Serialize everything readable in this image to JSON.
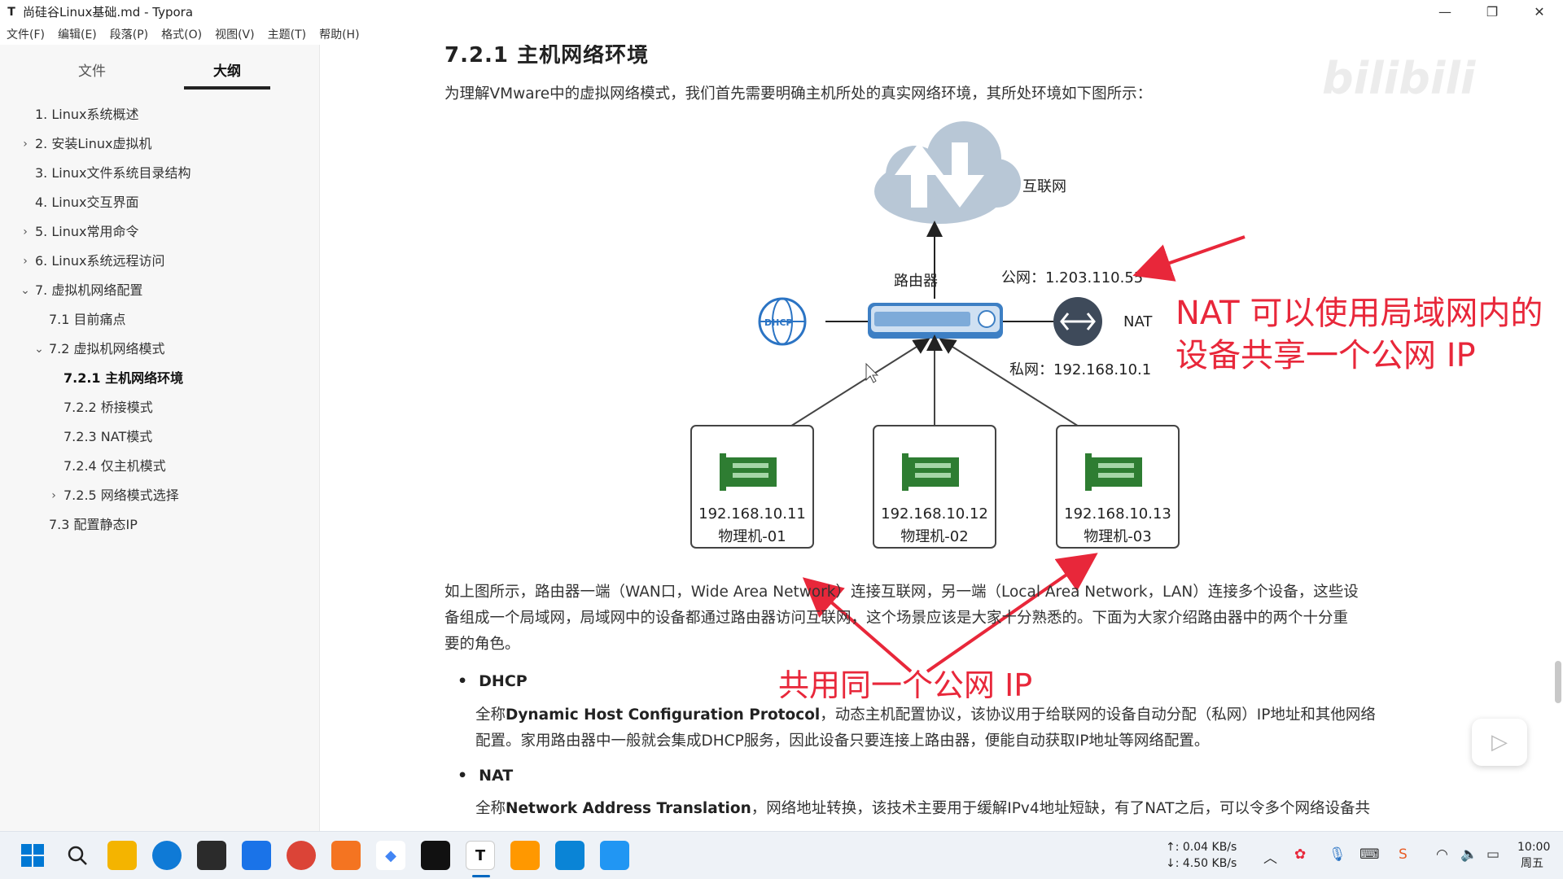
{
  "titlebar": {
    "app_icon": "T",
    "title": "尚硅谷Linux基础.md - Typora",
    "minimize": "—",
    "maximize": "❐",
    "close": "✕"
  },
  "menu": [
    "文件(F)",
    "编辑(E)",
    "段落(P)",
    "格式(O)",
    "视图(V)",
    "主题(T)",
    "帮助(H)"
  ],
  "sidebar": {
    "tabs": {
      "file": "文件",
      "outline": "大纲"
    },
    "outline": [
      {
        "label": "1. Linux系统概述",
        "chevron": ""
      },
      {
        "label": "2. 安装Linux虚拟机",
        "chevron": "›"
      },
      {
        "label": "3. Linux文件系统目录结构",
        "chevron": ""
      },
      {
        "label": "4. Linux交互界面",
        "chevron": ""
      },
      {
        "label": "5. Linux常用命令",
        "chevron": "›"
      },
      {
        "label": "6. Linux系统远程访问",
        "chevron": "›"
      },
      {
        "label": "7. 虚拟机网络配置",
        "chevron": "⌄"
      },
      {
        "label": "7.1 目前痛点",
        "chevron": ""
      },
      {
        "label": "7.2 虚拟机网络模式",
        "chevron": "⌄"
      },
      {
        "label": "7.2.1 主机网络环境",
        "chevron": ""
      },
      {
        "label": "7.2.2 桥接模式",
        "chevron": ""
      },
      {
        "label": "7.2.3 NAT模式",
        "chevron": ""
      },
      {
        "label": "7.2.4 仅主机模式",
        "chevron": ""
      },
      {
        "label": "7.2.5 网络模式选择",
        "chevron": "›"
      },
      {
        "label": "7.3 配置静态IP",
        "chevron": ""
      }
    ]
  },
  "content": {
    "heading": "7.2.1 主机网络环境",
    "intro": "为理解VMware中的虚拟网络模式，我们首先需要明确主机所处的真实网络环境，其所处环境如下图所示：",
    "diagram": {
      "internet_label": "互联网",
      "router_label": "路由器",
      "public_ip": "公网：1.203.110.55",
      "private_ip": "私网：192.168.10.1",
      "dhcp_label": "DHCP",
      "nat_label": "NAT",
      "machines": [
        {
          "ip": "192.168.10.11",
          "name": "物理机-01"
        },
        {
          "ip": "192.168.10.12",
          "name": "物理机-02"
        },
        {
          "ip": "192.168.10.13",
          "name": "物理机-03"
        }
      ]
    },
    "para1_line1": "如上图所示，路由器一端（WAN口，Wide Area Network）连接互联网，另一端（Local Area Network，LAN）连接多个设备，这些设",
    "para1_line2": "备组成一个局域网，局域网中的设备都通过路由器访问互联网，这个场景应该是大家十分熟悉的。下面为大家介绍路由器中的两个十分重",
    "para1_line3": "要的角色。",
    "dhcp_title": "DHCP",
    "dhcp_prefix": "全称",
    "dhcp_bold": "Dynamic Host Configuration Protocol",
    "dhcp_rest": "，动态主机配置协议，该协议用于给联网的设备自动分配（私网）IP地址和其他网络",
    "dhcp_line2": "配置。家用路由器中一般就会集成DHCP服务，因此设备只要连接上路由器，便能自动获取IP地址等网络配置。",
    "nat_title": "NAT",
    "nat_prefix": "全称",
    "nat_bold": "Network Address Translation",
    "nat_rest": "，网络地址转换，该技术主要用于缓解IPv4地址短缺，有了NAT之后，可以令多个网络设备共"
  },
  "annotations": {
    "nat_note_line1": "NAT 可以使用局域网内的",
    "nat_note_line2": "设备共享一个公网 IP",
    "shared_ip_note": "共用同一个公网 IP"
  },
  "watermark": "bilibili",
  "taskbar": {
    "net_up": "↑: 0.04 KB/s",
    "net_down": "↓: 4.50 KB/s",
    "time": "10:00",
    "weekday": "周五",
    "typora_icon": "T"
  },
  "colors": {
    "annotation": "#e8273a",
    "router_blue": "#3d7fc4",
    "nic_green": "#2e7d32",
    "cloud_gray": "#b8c7d6"
  }
}
